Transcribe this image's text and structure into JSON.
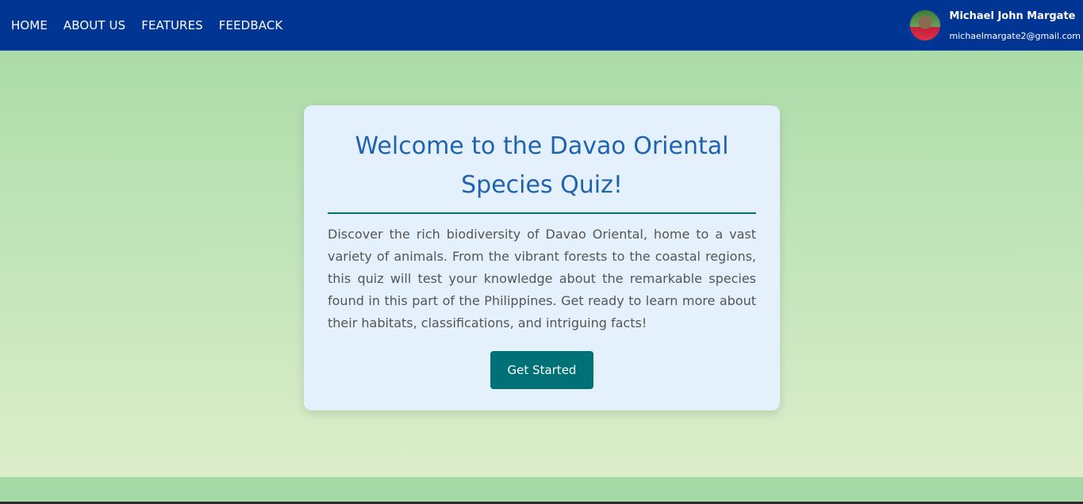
{
  "nav": {
    "links": [
      {
        "label": "HOME"
      },
      {
        "label": "ABOUT US"
      },
      {
        "label": "FEATURES"
      },
      {
        "label": "FEEDBACK"
      }
    ]
  },
  "profile": {
    "name": "Michael John Margate",
    "email": "michaelmargate2@gmail.com"
  },
  "card": {
    "title": "Welcome to the Davao Oriental Species Quiz!",
    "description": "Discover the rich biodiversity of Davao Oriental, home to a vast variety of animals. From the vibrant forests to the coastal regions, this quiz will test your knowledge about the remarkable species found in this part of the Philippines. Get ready to learn more about their habitats, classifications, and intriguing facts!",
    "button_label": "Get Started"
  },
  "colors": {
    "navbar": "#003594",
    "accent": "#007177",
    "title": "#1f63b0",
    "card_background": "#e4f1fc",
    "page_background": "#a4d9a6"
  }
}
